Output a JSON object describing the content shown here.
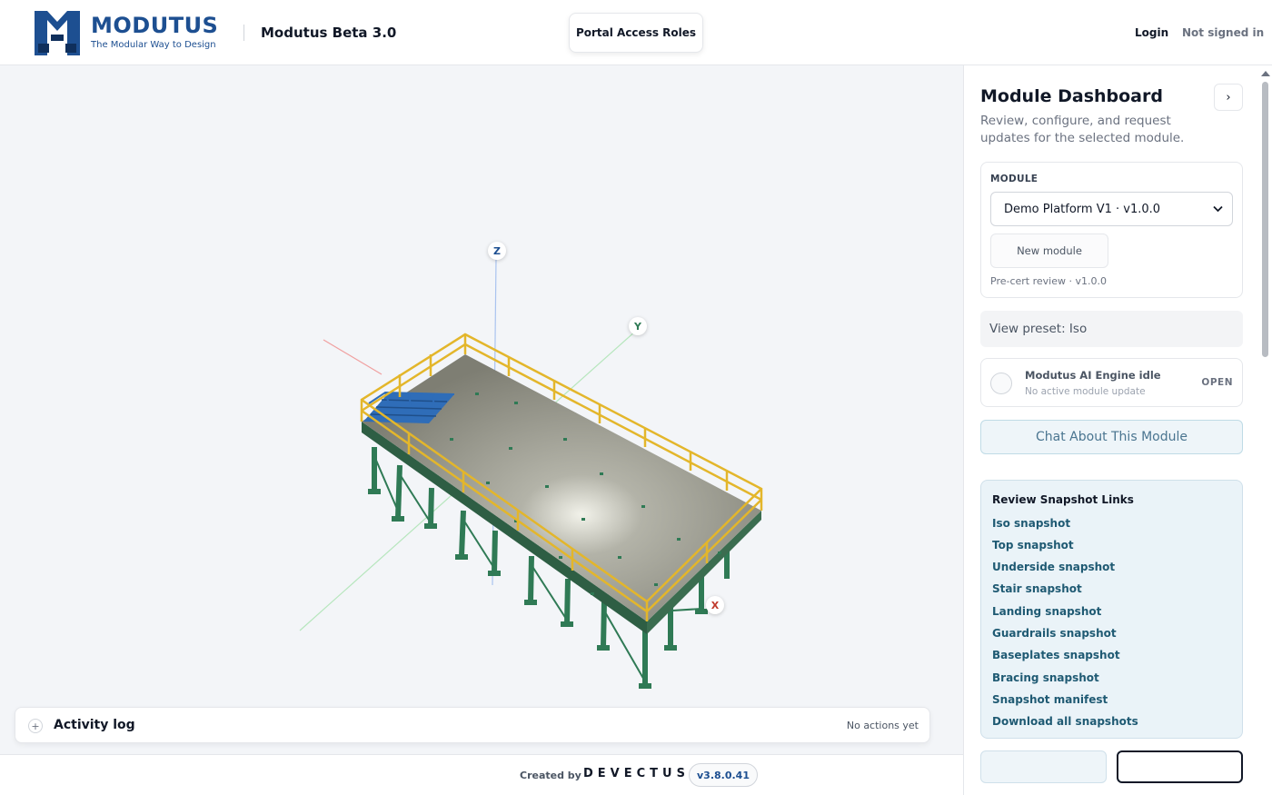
{
  "header": {
    "brand_name": "MODUTUS",
    "brand_tagline": "The Modular Way to Design",
    "app_title": "Modutus Beta 3.0",
    "portal_button": "Portal Access Roles",
    "login": "Login",
    "auth_status": "Not signed in"
  },
  "viewport": {
    "axes": {
      "z": "Z",
      "y": "Y",
      "x": "X"
    },
    "activity_log": {
      "title": "Activity log",
      "toggle": "+",
      "status": "No actions yet"
    }
  },
  "footer": {
    "created_by": "Created by",
    "company": "DEVECTUS",
    "version": "v3.8.0.41"
  },
  "sidebar": {
    "title": "Module Dashboard",
    "collapse_icon": "›",
    "description": "Review, configure, and request updates for the selected module.",
    "module": {
      "label": "MODULE",
      "selected": "Demo Platform V1 · v1.0.0",
      "new_button": "New module",
      "status": "Pre-cert review · v1.0.0"
    },
    "view_preset": "View preset: Iso",
    "ai_engine": {
      "title": "Modutus AI Engine idle",
      "subtitle": "No active module update",
      "action": "OPEN"
    },
    "chat_button": "Chat About This Module",
    "snapshots": {
      "title": "Review Snapshot Links",
      "links": [
        "Iso snapshot",
        "Top snapshot",
        "Underside snapshot",
        "Stair snapshot",
        "Landing snapshot",
        "Guardrails snapshot",
        "Baseplates snapshot",
        "Bracing snapshot",
        "Snapshot manifest",
        "Download all snapshots"
      ]
    }
  },
  "colors": {
    "brand_blue": "#1d4f91",
    "platform_deck": "#8a8a7e",
    "guardrail": "#e3b62b",
    "steel_frame": "#2f7a55",
    "stair": "#2f6db8",
    "axis_x": "#e06666",
    "axis_y": "#7fd38b",
    "axis_z": "#6b9be0"
  }
}
